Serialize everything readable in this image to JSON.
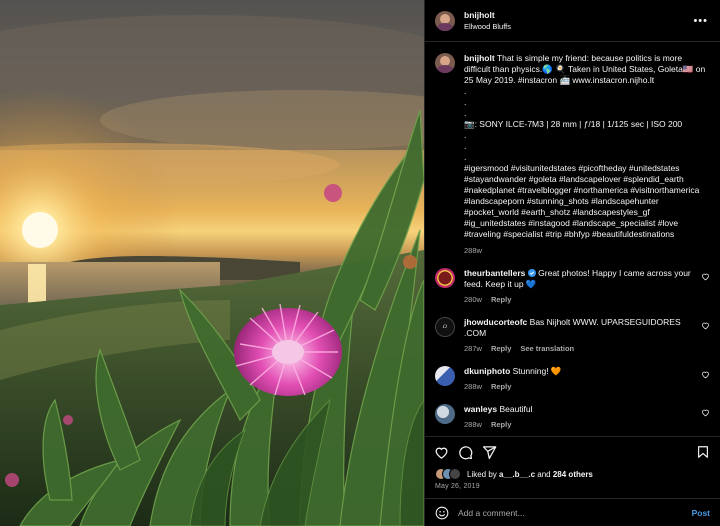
{
  "post": {
    "username": "bnijholt",
    "location": "Ellwood Bluffs",
    "more_icon": "more-horizontal-icon"
  },
  "caption": {
    "username": "bnijholt",
    "line1": "That is simple my friend: because politics is more difficult than physics.🌎 🍳 Taken in United States, Goleta🇺🇸 on 25 May 2019. #instacron 🚈 www.instacron.nijho.lt",
    "dots": ".\n.\n.",
    "camera": "📷: SONY ILCE-7M3 | 28 mm | ƒ/18 | 1/125 sec | ISO 200",
    "dots2": ".\n.\n.",
    "hashtags": "#igersmood #visitunitedstates #picoftheday #unitedstates #stayandwander #goleta #landscapelover #splendid_earth #nakedplanet #travelblogger #northamerica #visitnorthamerica #landscapeporn #stunning_shots #landscapehunter #pocket_world #earth_shotz #landscapestyles_gf #ig_unitedstates #instagood #landscape_specialist #love #traveling #specialist #trip #bhfyp #beautifuldestinations",
    "age": "288w"
  },
  "comments": [
    {
      "username": "theurbantellers",
      "verified": true,
      "text": "Great photos! Happy I came across your feed. Keep it up 💙",
      "age": "280w",
      "reply": "Reply",
      "translate": ""
    },
    {
      "username": "jhowducorteofc",
      "verified": false,
      "text": "Bas Nijholt WWW. UPARSEGUIDORES .COM",
      "age": "287w",
      "reply": "Reply",
      "translate": "See translation"
    },
    {
      "username": "dkuniphoto",
      "verified": false,
      "text": "Stunning! 🧡",
      "age": "288w",
      "reply": "Reply",
      "translate": ""
    },
    {
      "username": "wanleys",
      "verified": false,
      "text": "Beautiful",
      "age": "288w",
      "reply": "Reply",
      "translate": ""
    }
  ],
  "actions": {
    "icons": [
      "heart-icon",
      "comment-icon",
      "share-icon",
      "bookmark-icon"
    ],
    "liked_by_prefix": "Liked by ",
    "liked_by_user": "a__.b__.c",
    "liked_by_and": " and ",
    "liked_by_others": "284 others",
    "date": "May 26, 2019"
  },
  "composer": {
    "placeholder": "Add a comment...",
    "post_label": "Post",
    "emoji_icon": "smiley-icon"
  },
  "colors": {
    "background": "#000000",
    "text": "#f5f5f5",
    "muted": "#a8a8a8",
    "link_blue": "#4a9ce8",
    "verified_blue": "#3897f0"
  }
}
